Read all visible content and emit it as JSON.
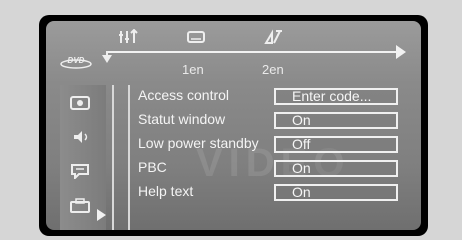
{
  "toolbar": {
    "icons": [
      "audio-settings-icon",
      "subtitle-icon",
      "camera-angle-icon"
    ],
    "languages": [
      "1en",
      "2en"
    ],
    "logo_text": "DVD"
  },
  "sidebar": {
    "icons": [
      "picture-settings-icon",
      "sound-settings-icon",
      "language-settings-icon",
      "features-icon"
    ],
    "selected_index": 3
  },
  "settings": [
    {
      "label": "Access control",
      "value": "Enter code..."
    },
    {
      "label": "Statut window",
      "value": "On"
    },
    {
      "label": "Low power standby",
      "value": "Off"
    },
    {
      "label": "PBC",
      "value": "On"
    },
    {
      "label": "Help text",
      "value": "On"
    }
  ],
  "watermark": "VIDEO"
}
